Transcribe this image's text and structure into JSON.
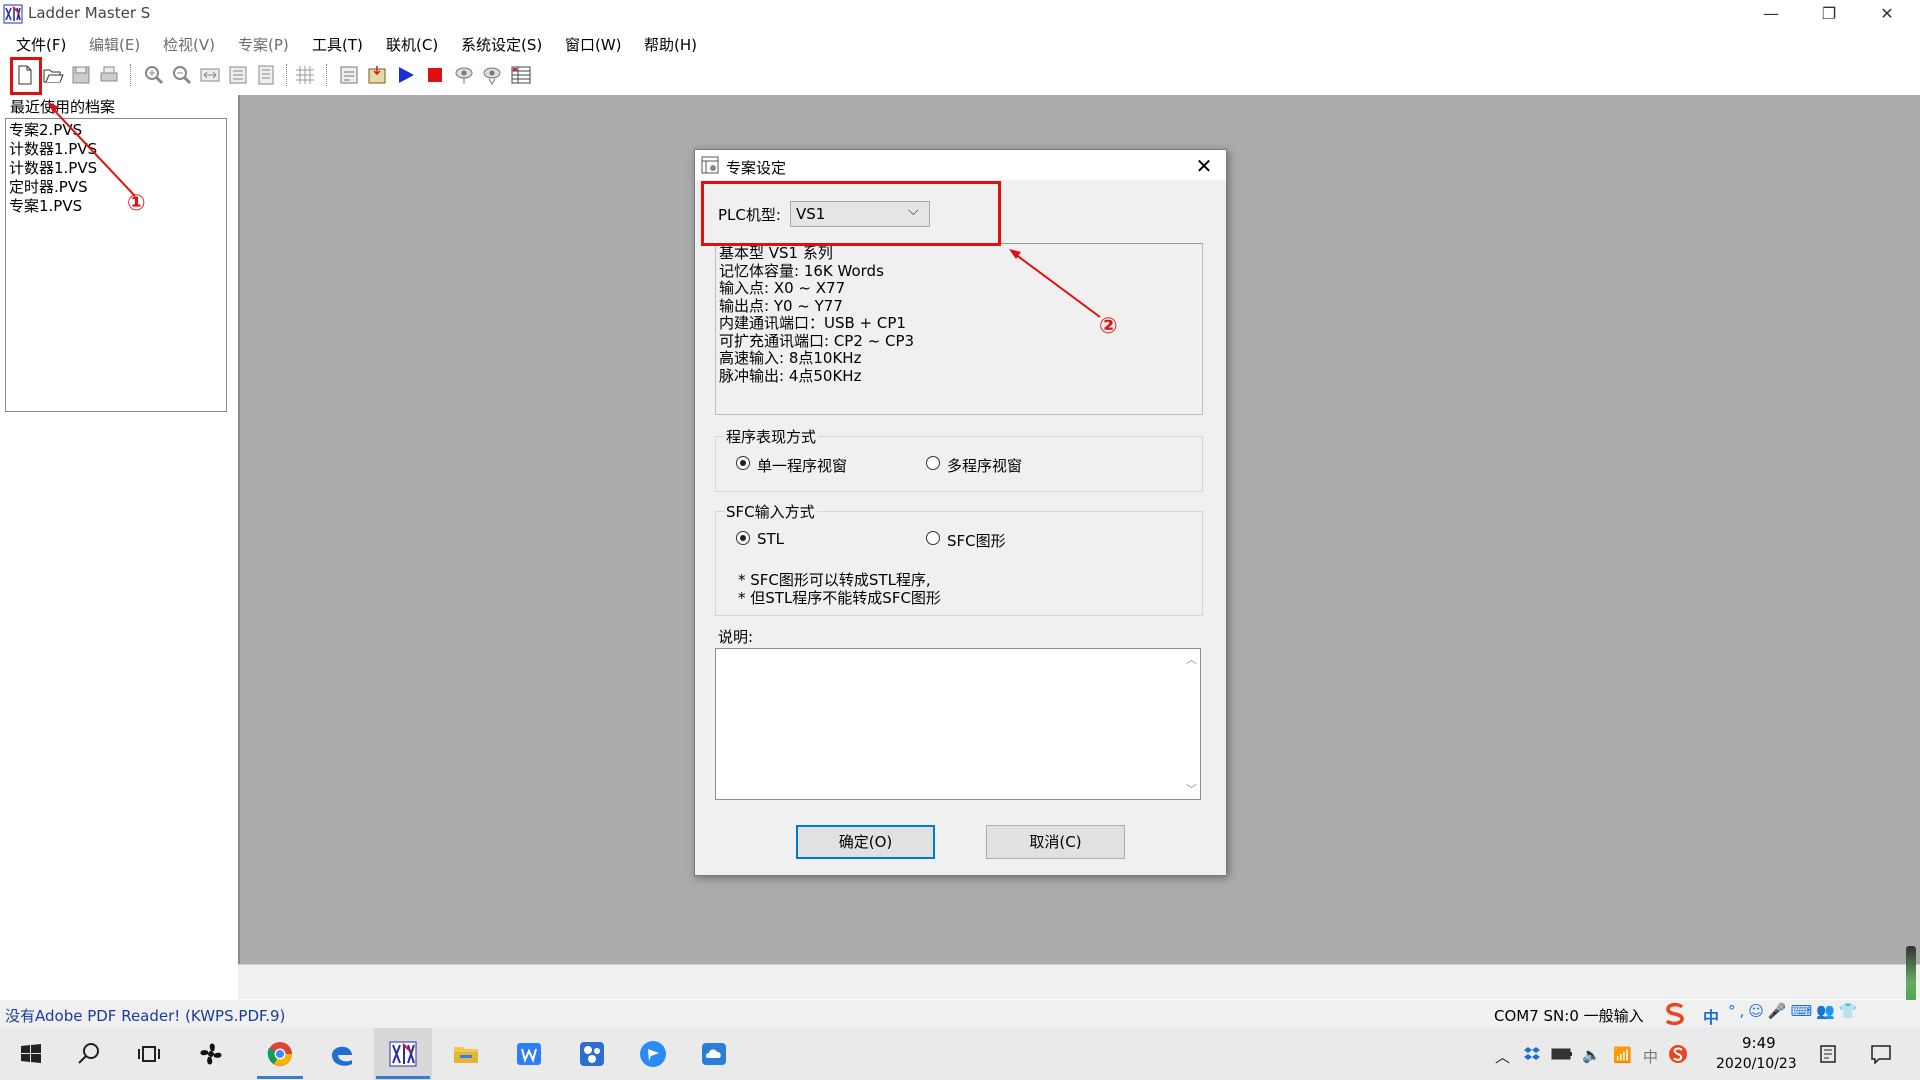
{
  "window": {
    "title": "Ladder Master S",
    "minimize": "—",
    "restore": "❐",
    "close": "✕"
  },
  "menu": [
    {
      "label": "文件(F)",
      "enabled": true
    },
    {
      "label": "编辑(E)",
      "enabled": false
    },
    {
      "label": "检视(V)",
      "enabled": false
    },
    {
      "label": "专案(P)",
      "enabled": false
    },
    {
      "label": "工具(T)",
      "enabled": true
    },
    {
      "label": "联机(C)",
      "enabled": true
    },
    {
      "label": "系统设定(S)",
      "enabled": true
    },
    {
      "label": "窗口(W)",
      "enabled": true
    },
    {
      "label": "帮助(H)",
      "enabled": true
    }
  ],
  "recent": {
    "label": "最近使用的档案",
    "files": [
      "专案2.PVS",
      "计数器1.PVS",
      "计数器1.PVS",
      "定时器.PVS",
      "专案1.PVS"
    ]
  },
  "dialog": {
    "title": "专案设定",
    "plc_label": "PLC机型:",
    "plc_value": "VS1",
    "info_lines": [
      "基本型 VS1 系列",
      "记忆体容量: 16K Words",
      "输入点: X0 ~ X77",
      "输出点: Y0 ~ Y77",
      "内建通讯端口：USB + CP1",
      "可扩充通讯端口: CP2 ~ CP3",
      "高速输入: 8点10KHz",
      "脉冲输出: 4点50KHz"
    ],
    "program_group": {
      "title": "程序表现方式",
      "option1": "单一程序视窗",
      "option2": "多程序视窗",
      "selected": 1
    },
    "sfc_group": {
      "title": "SFC输入方式",
      "option1": "STL",
      "option2": "SFC图形",
      "selected": 1,
      "note1": "* SFC图形可以转成STL程序,",
      "note2": "* 但STL程序不能转成SFC图形"
    },
    "desc_label": "说明:",
    "ok": "确定(O)",
    "cancel": "取消(C)"
  },
  "annotations": {
    "one": "①",
    "two": "②",
    "color": "#e01010"
  },
  "status": {
    "left": "没有Adobe PDF Reader! (KWPS.PDF.9)",
    "right": "COM7 SN:0   一般输入"
  },
  "taskbar": {
    "time": "9:49",
    "date": "2020/10/23",
    "ime": "中",
    "lang": "中"
  }
}
